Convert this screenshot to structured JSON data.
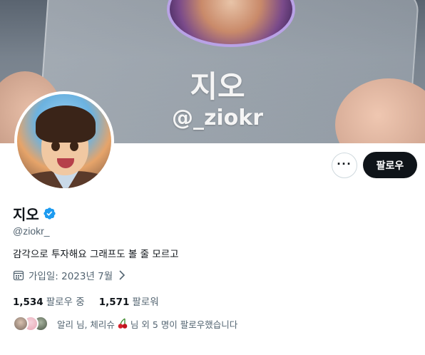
{
  "banner": {
    "card_name": "지오",
    "card_handle": "@_ziokr"
  },
  "actions": {
    "more_label": "···",
    "follow_label": "팔로우"
  },
  "profile": {
    "display_name": "지오",
    "handle": "@ziokr_",
    "bio": "감각으로 투자해요 그래프도 볼 줄 모르고",
    "joined": "가입일: 2023년 7월",
    "verified_color": "#1d9bf0"
  },
  "stats": {
    "following_count": "1,534",
    "following_label": "팔로우 중",
    "followers_count": "1,571",
    "followers_label": "팔로워"
  },
  "followed_by": {
    "text_before": "알리 님, 체리슈",
    "text_after": "님 외 5 명이 팔로우했습니다"
  }
}
